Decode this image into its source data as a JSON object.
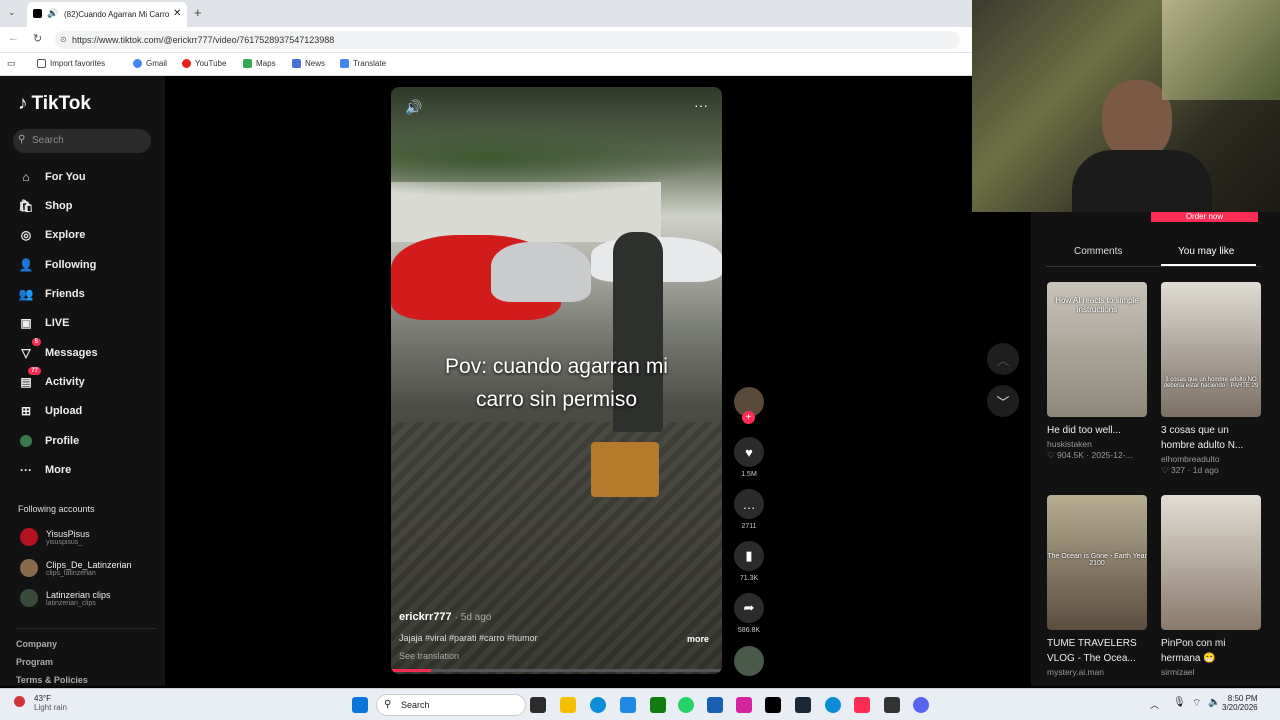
{
  "browser": {
    "tab_title": "(82)Cuando Agarran Mi Carro",
    "url": "https://www.tiktok.com/@erickrr777/video/7617528937547123988",
    "bookmarks": [
      "Import favorites",
      "Gmail",
      "YouTube",
      "Maps",
      "News",
      "Translate"
    ]
  },
  "sidebar": {
    "brand": "TikTok",
    "search_placeholder": "Search",
    "nav": [
      {
        "label": "For You",
        "icon": "home-icon"
      },
      {
        "label": "Shop",
        "icon": "shop-icon"
      },
      {
        "label": "Explore",
        "icon": "compass-icon"
      },
      {
        "label": "Following",
        "icon": "following-icon"
      },
      {
        "label": "Friends",
        "icon": "friends-icon"
      },
      {
        "label": "LIVE",
        "icon": "live-icon"
      },
      {
        "label": "Messages",
        "icon": "messages-icon",
        "badge": "5"
      },
      {
        "label": "Activity",
        "icon": "activity-icon",
        "badge": "77"
      },
      {
        "label": "Upload",
        "icon": "upload-icon"
      },
      {
        "label": "Profile",
        "icon": "profile-icon"
      },
      {
        "label": "More",
        "icon": "more-icon"
      }
    ],
    "following_title": "Following accounts",
    "accounts": [
      {
        "name": "YisusPisus",
        "handle": "yisuspisus_"
      },
      {
        "name": "Clips_De_Latinzerian",
        "handle": "clips_latinzerian"
      },
      {
        "name": "Latinzerian clips",
        "handle": "latinzerian_clips"
      }
    ],
    "footer": [
      "Company",
      "Program",
      "Terms & Policies"
    ]
  },
  "video": {
    "caption_line1": "Pov: cuando agarran mi",
    "caption_line2": "carro sin permiso",
    "author": "erickrr777",
    "age": "· 5d ago",
    "description": "Jajaja #viral #parati #carro #humor",
    "more": "more",
    "see_translation": "See translation",
    "progress": 0.12
  },
  "actions": {
    "likes": "1.5M",
    "comments": "2711",
    "saves": "71.3K",
    "shares": "586.8K"
  },
  "right_panel": {
    "order_now": "Order now",
    "tab_comments": "Comments",
    "tab_may_like": "You may like",
    "cards": [
      {
        "overlay": "How AI reacts to simple instructions",
        "title": "He did too well...",
        "user": "huskistaken",
        "meta": "♡ 904.5K · 2025-12-..."
      },
      {
        "overlay": "3 cosas que un hombre adulto NO debería estar haciendo · PARTE 29",
        "title": "3 cosas que un hombre adulto N...",
        "user": "elhombreadulto",
        "meta": "♡ 327 · 1d ago"
      },
      {
        "overlay": "The Ocean is Gone - Earth Year 2100",
        "title": "TUME TRAVELERS VLOG - The Ocea...",
        "user": "mystery.ai.man",
        "meta": ""
      },
      {
        "overlay": "",
        "title": "PinPon con mi hermana 😁",
        "user": "sirmizael",
        "meta": ""
      }
    ]
  },
  "taskbar": {
    "temp": "43°F",
    "weather": "Light rain",
    "search": "Search",
    "time": "8:50 PM",
    "date": "3/20/2026"
  },
  "colors": {
    "accent": "#fe2c55",
    "bg": "#000000",
    "sidebar": "#121212"
  }
}
